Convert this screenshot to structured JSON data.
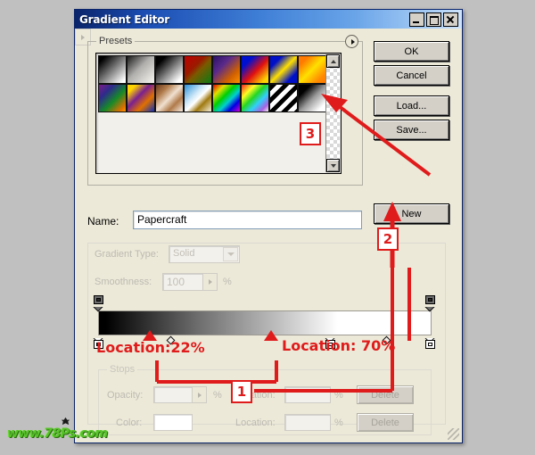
{
  "window": {
    "title": "Gradient Editor",
    "controls": [
      {
        "name": "minimize",
        "glyph": "_"
      },
      {
        "name": "maximize",
        "glyph": "□"
      },
      {
        "name": "close",
        "glyph": "×"
      }
    ]
  },
  "presets": {
    "label": "Presets",
    "menu_icon": "right-triangle-icon",
    "scroll_up_icon": "scroll-up-arrow",
    "scroll_down_icon": "scroll-down-arrow",
    "swatches": [
      {
        "name": "foreground-to-background",
        "css": "linear-gradient(135deg,#000 0%,#000 12%,#ffffff 92%,#ffffff 100%)"
      },
      {
        "name": "foreground-to-transparent",
        "css": "linear-gradient(135deg,#1a1a1a 0%,rgba(120,120,120,0.55) 45%,rgba(255,255,255,0) 95%)"
      },
      {
        "name": "black-white",
        "css": "linear-gradient(135deg,#000 0%,#000 18%,#ffffff 88%,#ffffff 100%)"
      },
      {
        "name": "red-green",
        "css": "linear-gradient(135deg,#c00000 0%,#9a1a00 38%,#7a5a00 55%,#0c7a14 100%)"
      },
      {
        "name": "violet-orange",
        "css": "linear-gradient(135deg,#2a1166 0%,#5a2a8a 35%,#d06000 72%,#ff9000 100%)"
      },
      {
        "name": "blue-red-yellow",
        "css": "linear-gradient(135deg,#0010d0 0%,#0010d0 22%,#e01010 55%,#ffd400 88%,#ffd400 100%)"
      },
      {
        "name": "blue-yellow-blue",
        "css": "linear-gradient(135deg,#0010c8 0%,#0010c8 22%,#ffe000 50%,#0010c8 80%,#0010c8 100%)"
      },
      {
        "name": "orange-yellow-orange",
        "css": "linear-gradient(135deg,#ff7a00 0%,#ff7a00 18%,#ffe000 50%,#ff8a00 82%,#ff7a00 100%)"
      },
      {
        "name": "violet-green-orange",
        "css": "linear-gradient(135deg,#7a1c8a 0%,#2c2c8a 28%,#168a28 58%,#e07000 88%,#ff9a00 100%)"
      },
      {
        "name": "yellow-violet-orange-blue",
        "css": "linear-gradient(135deg,#ffd400 0%,#ffd400 16%,#7a2090 42%,#e07000 68%,#1030b8 100%)"
      },
      {
        "name": "copper",
        "css": "linear-gradient(135deg,#6a3a1c 0%,#b07a4a 25%,#f0e0d0 50%,#b07a4a 72%,#f7ece2 100%)"
      },
      {
        "name": "chrome",
        "css": "linear-gradient(135deg,#2a90d8 0%,#cfe8f8 38%,#ffffff 52%,#a07a10 70%,#f5efdc 100%)"
      },
      {
        "name": "spectrum",
        "css": "linear-gradient(135deg,#e00000 0%,#e0e000 22%,#00d000 42%,#00d0d0 60%,#0000e0 78%,#d000d0 100%)"
      },
      {
        "name": "transparent-rainbow",
        "css": "linear-gradient(135deg,rgba(255,0,0,0.85) 0%,rgba(255,255,0,0.85) 25%,rgba(0,210,0,0.85) 45%,rgba(0,200,255,0.8) 65%,rgba(120,0,220,0.6) 85%,rgba(255,255,255,0) 100%)"
      },
      {
        "name": "transparent-stripes",
        "css": "repeating-linear-gradient(135deg,#000 0 5px,#ffffff 5px 10px)"
      },
      {
        "name": "black-to-white-soft",
        "css": "linear-gradient(135deg,#000 0%,#000 22%,#9a9a9a 52%,#ffffff 85%,#ffffff 100%)"
      }
    ]
  },
  "buttons": {
    "ok": "OK",
    "cancel": "Cancel",
    "load": "Load...",
    "save": "Save...",
    "new": "New"
  },
  "name_row": {
    "label": "Name:",
    "value": "Papercraft"
  },
  "gradient_type": {
    "label": "Gradient Type:",
    "value": "Solid",
    "dropdown_icon": "chevron-down-icon",
    "disabled": true
  },
  "smoothness": {
    "label": "Smoothness:",
    "value": "100",
    "percent": "%",
    "spinner_icon": "right-triangle-icon",
    "disabled": true
  },
  "gradient_bar": {
    "css": "linear-gradient(to right,#000 0%, #000 2%, #6e6e6e 30%, #c2c2c2 55%, #ffffff 72%, #ffffff 100%)",
    "opacity_stops": [
      {
        "name": "opacity-stop-left",
        "position": 0,
        "color": "#6e6e6e"
      },
      {
        "name": "opacity-stop-right",
        "position": 100,
        "color": "#6e6e6e"
      }
    ],
    "color_stops": [
      {
        "name": "color-stop-black",
        "position": 0,
        "color": "#000000"
      },
      {
        "name": "color-stop-white-mid",
        "position": 70,
        "color": "#ffffff"
      },
      {
        "name": "color-stop-white-end",
        "position": 100,
        "color": "#ffffff"
      }
    ],
    "midpoints": [
      {
        "name": "midpoint-diamond-left",
        "position": 22
      },
      {
        "name": "midpoint-diamond-right",
        "position": 87
      }
    ]
  },
  "stops": {
    "label": "Stops",
    "opacity": {
      "label": "Opacity:",
      "value": "",
      "percent": "%",
      "location_label": "Location:",
      "location_value": "",
      "location_percent": "%",
      "delete_label": "Delete",
      "spinner_icon": "right-triangle-icon"
    },
    "color": {
      "label": "Color:",
      "swatch": "#ffffff",
      "picker_icon": "right-triangle-icon",
      "location_label": "Location:",
      "location_value": "",
      "location_percent": "%",
      "delete_label": "Delete"
    }
  },
  "annotations": {
    "location_22": "Location:22%",
    "location_70": "Location: 70%",
    "marker_1": "1",
    "marker_2": "2",
    "marker_3": "3",
    "color": "#e01b1b"
  },
  "watermark": {
    "text": "www.78Ps.com",
    "color": "#57c22a"
  }
}
